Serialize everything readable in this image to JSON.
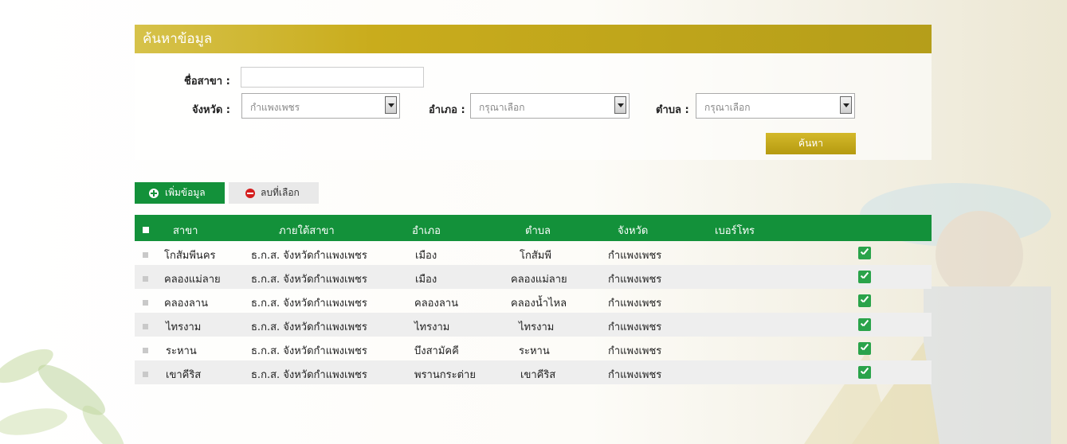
{
  "search": {
    "title": "ค้นหาข้อมูล",
    "branch_label": "ชื่อสาขา :",
    "branch_value": "",
    "province_label": "จังหวัด :",
    "province_value": "กำแพงเพชร",
    "district_label": "อำเภอ :",
    "district_value": "กรุณาเลือก",
    "subdistrict_label": "ตำบล :",
    "subdistrict_value": "กรุณาเลือก",
    "search_button": "ค้นหา"
  },
  "actions": {
    "add_label": "เพิ่มข้อมูล",
    "delete_label": "ลบที่เลือก"
  },
  "table": {
    "headers": [
      "สาขา",
      "ภายใต้สาขา",
      "อำเภอ",
      "ตำบล",
      "จังหวัด",
      "เบอร์โทร"
    ],
    "rows": [
      {
        "branch": "โกสัมพีนคร",
        "parent": "ธ.ก.ส. จังหวัดกำแพงเพชร",
        "district": "เมือง",
        "subdistrict": "โกสัมพี",
        "province": "กำแพงเพชร",
        "phone": ""
      },
      {
        "branch": "คลองแม่ลาย",
        "parent": "ธ.ก.ส. จังหวัดกำแพงเพชร",
        "district": "เมือง",
        "subdistrict": "คลองแม่ลาย",
        "province": "กำแพงเพชร",
        "phone": ""
      },
      {
        "branch": "คลองลาน",
        "parent": "ธ.ก.ส. จังหวัดกำแพงเพชร",
        "district": "คลองลาน",
        "subdistrict": "คลองน้ำไหล",
        "province": "กำแพงเพชร",
        "phone": ""
      },
      {
        "branch": "ไทรงาม",
        "parent": "ธ.ก.ส. จังหวัดกำแพงเพชร",
        "district": "ไทรงาม",
        "subdistrict": "ไทรงาม",
        "province": "กำแพงเพชร",
        "phone": ""
      },
      {
        "branch": "ระหาน",
        "parent": "ธ.ก.ส. จังหวัดกำแพงเพชร",
        "district": "บึงสามัคคี",
        "subdistrict": "ระหาน",
        "province": "กำแพงเพชร",
        "phone": ""
      },
      {
        "branch": "เขาคีริส",
        "parent": "ธ.ก.ส. จังหวัดกำแพงเพชร",
        "district": "พรานกระต่าย",
        "subdistrict": "เขาคีริส",
        "province": "กำแพงเพชร",
        "phone": ""
      }
    ]
  },
  "colors": {
    "header_gold": "#c9ac1c",
    "table_green": "#13913a",
    "delete_red": "#d41e1e"
  }
}
